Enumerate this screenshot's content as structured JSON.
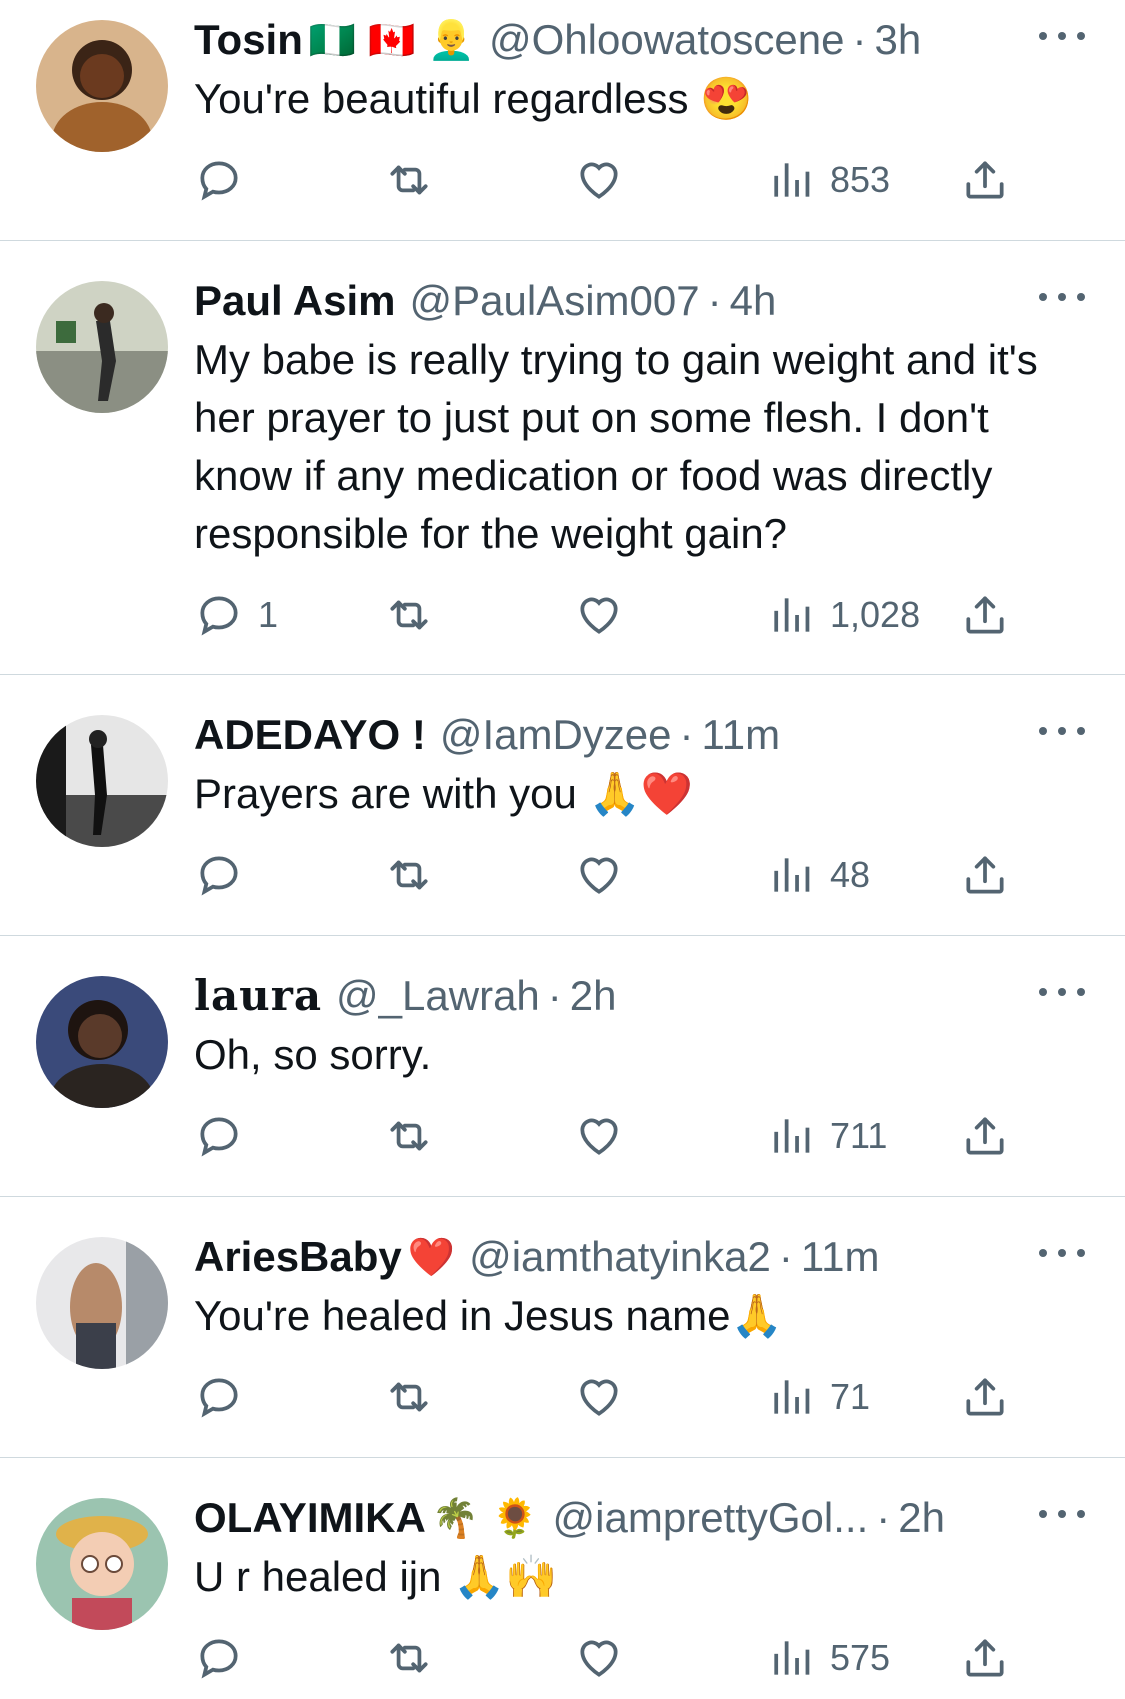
{
  "tweets": [
    {
      "name": "Tosin",
      "name_emoji": "🇳🇬 🇨🇦 👱‍♂️",
      "handle": "@Ohloowatoscene",
      "dot": "·",
      "time": "3h",
      "text": "You're beautiful regardless 😍",
      "reply_count": "",
      "views": "853",
      "avatar_color": "#6b3a1f"
    },
    {
      "name": "Paul Asim",
      "name_emoji": "",
      "handle": "@PaulAsim007",
      "dot": "·",
      "time": "4h",
      "text": "My babe is really trying to gain weight and it's her prayer to just put on some flesh. I don't know if any medication or food was directly responsible for the weight gain?",
      "reply_count": "1",
      "views": "1,028",
      "avatar_color": "#7a8a6a"
    },
    {
      "name": "ADEDAYO !",
      "name_emoji": "",
      "handle": "@IamDyzee",
      "dot": "·",
      "time": "11m",
      "text": "Prayers are with you 🙏❤️",
      "reply_count": "",
      "views": "48",
      "avatar_color": "#3a3a3a"
    },
    {
      "name": "laura",
      "name_emoji": "",
      "handle": "@_Lawrah",
      "dot": "·",
      "time": "2h",
      "text": "Oh, so sorry.",
      "reply_count": "",
      "views": "711",
      "avatar_color": "#5a3a2a"
    },
    {
      "name": "AriesBaby",
      "name_emoji": "❤️",
      "handle": "@iamthatyinka2",
      "dot": "·",
      "time": "11m",
      "text": "You're healed in Jesus name🙏",
      "reply_count": "",
      "views": "71",
      "avatar_color": "#8a7a6a"
    },
    {
      "name": "OLAYIMIKA",
      "name_emoji": "🌴 🌻",
      "handle": "@iamprettyGol...",
      "dot": "·",
      "time": "2h",
      "text": "U r healed ijn 🙏🙌",
      "reply_count": "",
      "views": "575",
      "avatar_color": "#9bc4b0"
    }
  ],
  "icons": {
    "reply": "reply-icon",
    "retweet": "retweet-icon",
    "like": "like-icon",
    "views": "views-icon",
    "share": "share-icon",
    "more": "more-icon"
  },
  "colors": {
    "text": "#0f1419",
    "secondary": "#536471",
    "divider": "#cfd9de"
  }
}
